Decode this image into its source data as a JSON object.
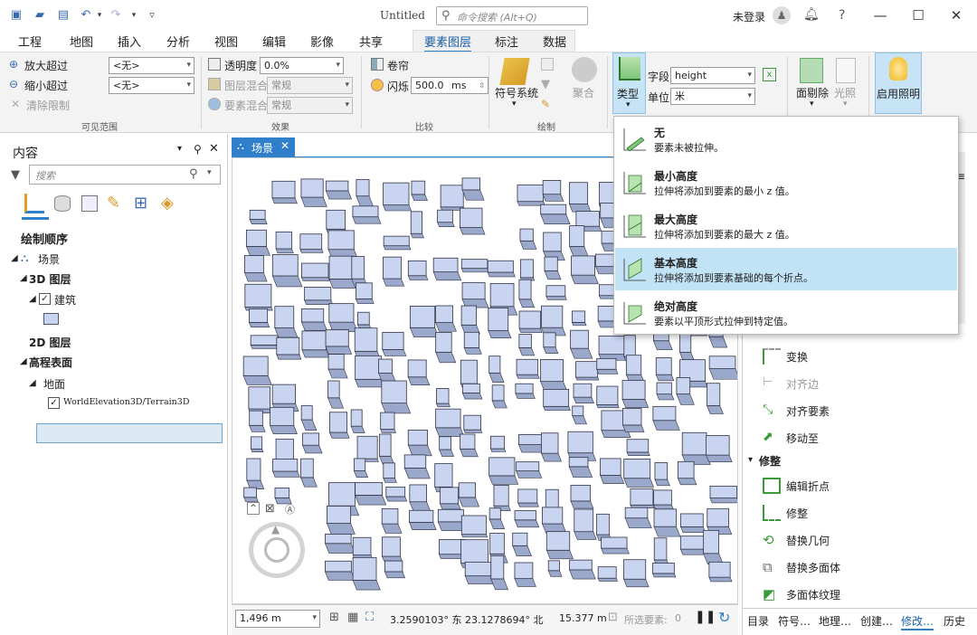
{
  "titlebar": {
    "doc_title": "Untitled",
    "search_placeholder": "命令搜索 (Alt+Q)",
    "user": "未登录"
  },
  "tabs": [
    "工程",
    "地图",
    "插入",
    "分析",
    "视图",
    "编辑",
    "影像",
    "共享",
    "要素图层",
    "标注",
    "数据"
  ],
  "ribbon": {
    "visible_range": {
      "zoom_in_label": "放大超过",
      "zoom_out_label": "缩小超过",
      "clear_label": "清除限制",
      "zoom_in_value": "<无>",
      "zoom_out_value": "<无>",
      "group": "可见范围"
    },
    "effects": {
      "transparency_label": "透明度",
      "transparency_value": "0.0%",
      "layer_blend_label": "图层混合",
      "layer_blend_value": "常规",
      "feature_blend_label": "要素混合",
      "feature_blend_value": "常规",
      "group": "效果"
    },
    "compare": {
      "swipe_label": "卷帘",
      "flicker_label": "闪烁",
      "flicker_value": "500.0",
      "flicker_unit": "ms",
      "group": "比较"
    },
    "drawing": {
      "symbology_label": "符号系统",
      "aggregate_label": "聚合",
      "group": "绘制"
    },
    "extrusion": {
      "type_label": "类型",
      "field_label": "字段",
      "field_value": "height",
      "unit_label": "单位",
      "unit_value": "米"
    },
    "faces": {
      "face_culling_label": "面剔除",
      "lighting_label": "光照",
      "enable_lighting_label": "启用照明"
    }
  },
  "contents": {
    "title": "内容",
    "search_placeholder": "搜索",
    "drawing_order": "绘制顺序",
    "scene": "场景",
    "layers_3d": "3D 图层",
    "building": "建筑",
    "layers_2d": "2D 图层",
    "elevation": "高程表面",
    "ground": "地面",
    "terrain": "WorldElevation3D/Terrain3D"
  },
  "map": {
    "tab_label": "场景",
    "scale": "1,496 m",
    "coords": "3.2590103° 东 23.1278694° 北",
    "elevation": "15.377 m",
    "selected_label": "所选要素:",
    "selected_count": "0"
  },
  "modify_panel": {
    "items_top": [
      "变换",
      "对齐边",
      "对齐要素",
      "移动至"
    ],
    "section": "修整",
    "items_reshape": [
      "编辑折点",
      "修整",
      "替换几何",
      "替换多面体",
      "多面体纹理"
    ]
  },
  "bottom_tabs": [
    "目录",
    "符号…",
    "地理…",
    "创建…",
    "修改…",
    "历史"
  ],
  "dropdown": [
    {
      "title": "无",
      "desc": "要素未被拉伸。"
    },
    {
      "title": "最小高度",
      "desc": "拉伸将添加到要素的最小 z 值。"
    },
    {
      "title": "最大高度",
      "desc": "拉伸将添加到要素的最大 z 值。"
    },
    {
      "title": "基本高度",
      "desc": "拉伸将添加到要素基础的每个折点。"
    },
    {
      "title": "绝对高度",
      "desc": "要素以平顶形式拉伸到特定值。"
    }
  ],
  "colors": {
    "accent": "#2f7fca",
    "highlight": "#c2e2f5",
    "building_fill": "#c8d4f0"
  }
}
